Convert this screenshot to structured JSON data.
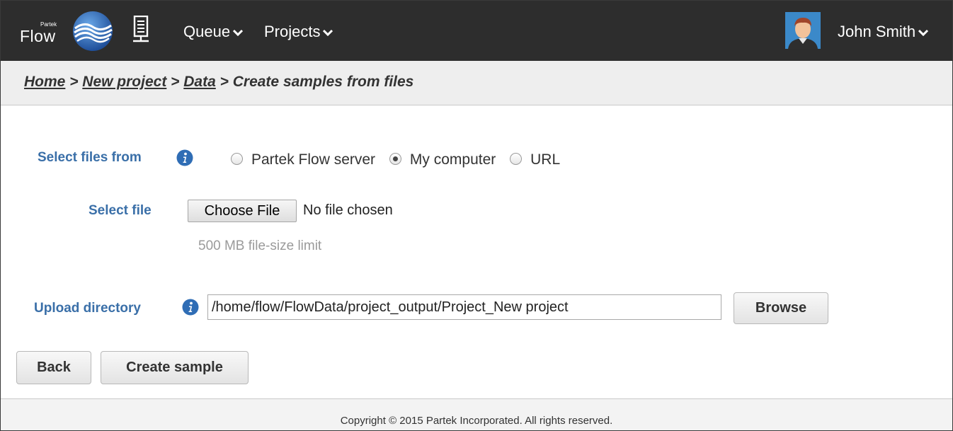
{
  "header": {
    "logo_small": "Partek",
    "logo_text": "Flow",
    "nav": [
      {
        "label": "Queue"
      },
      {
        "label": "Projects"
      }
    ],
    "user_name": "John Smith"
  },
  "breadcrumb": {
    "home": "Home",
    "sep1": " > ",
    "project": "New project",
    "sep2": " > ",
    "data": "Data",
    "sep3": " > ",
    "current": "Create samples from files"
  },
  "form": {
    "select_files_label": "Select files from",
    "radio_options": [
      {
        "label": "Partek Flow server",
        "checked": false
      },
      {
        "label": "My computer",
        "checked": true
      },
      {
        "label": "URL",
        "checked": false
      }
    ],
    "select_file_label": "Select file",
    "choose_file_label": "Choose File",
    "no_file_text": "No file chosen",
    "size_limit_hint": "500 MB file-size limit",
    "upload_dir_label": "Upload directory",
    "upload_dir_value": "/home/flow/FlowData/project_output/Project_New project",
    "browse_label": "Browse"
  },
  "actions": {
    "back_label": "Back",
    "create_label": "Create sample"
  },
  "footer": {
    "copyright": "Copyright © 2015 Partek Incorporated. All rights reserved."
  },
  "colors": {
    "topbar": "#2d2d2d",
    "label_blue": "#3a6fa8",
    "info_blue": "#2f6db5"
  }
}
